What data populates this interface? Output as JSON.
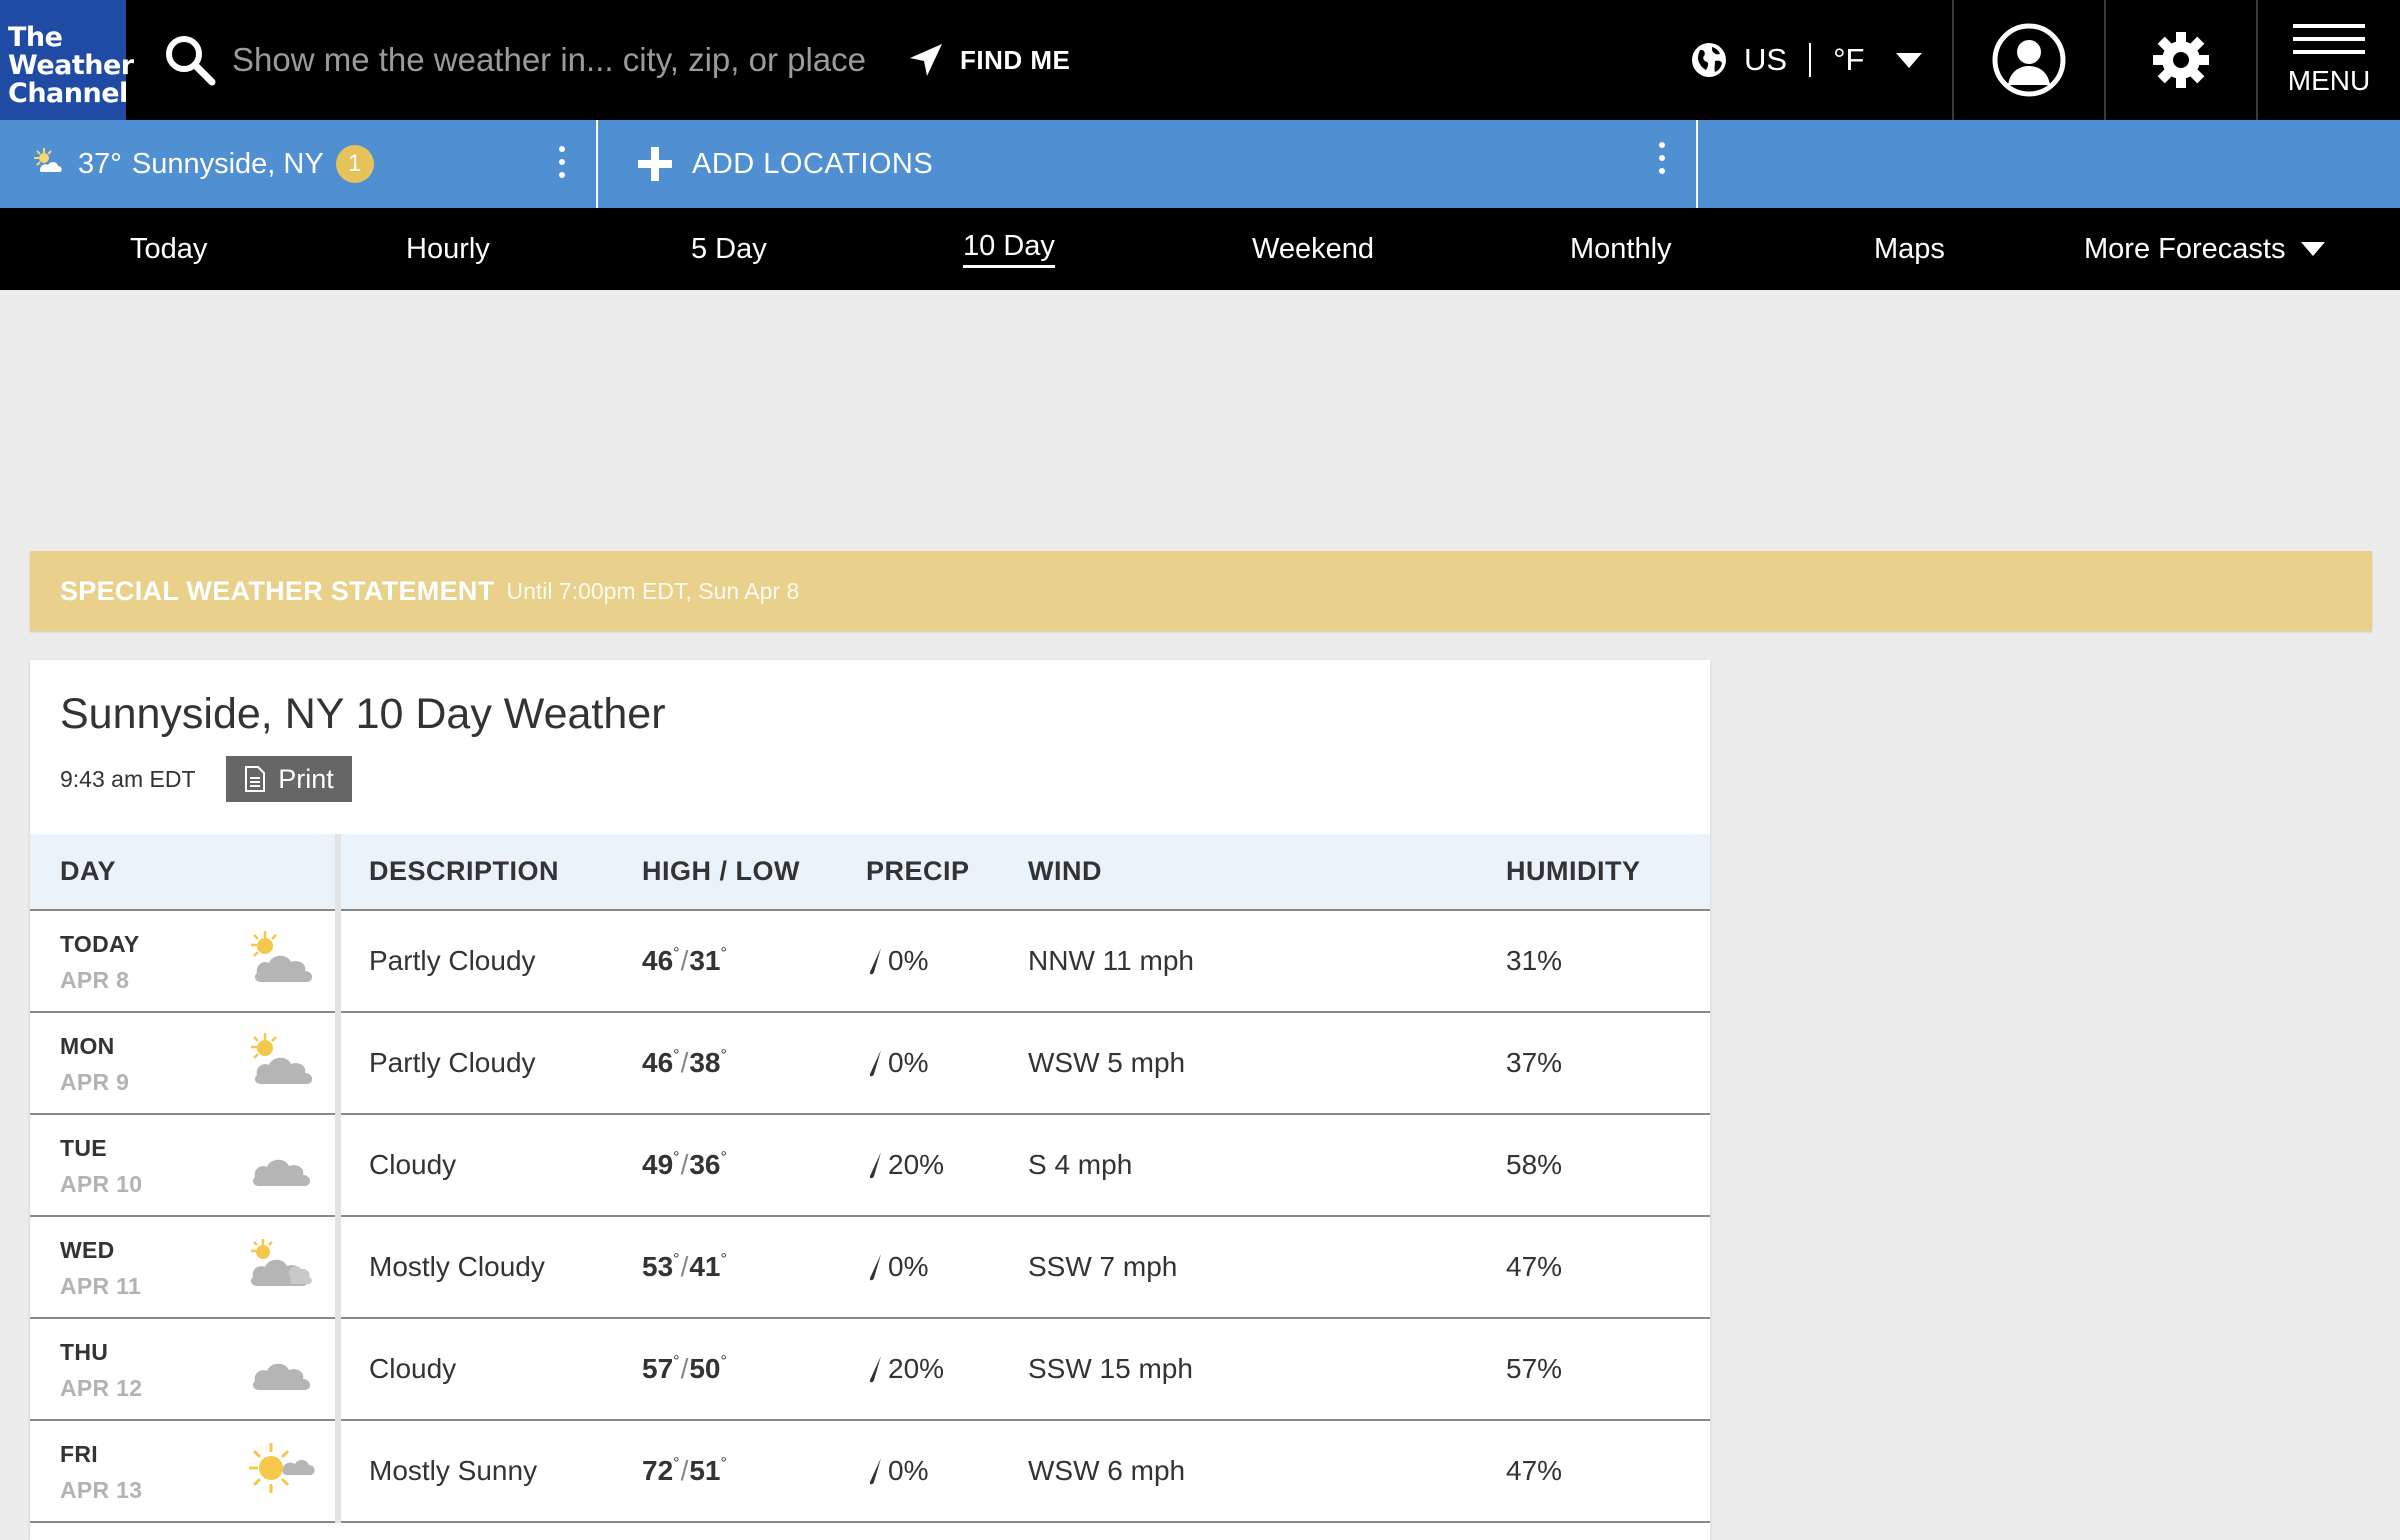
{
  "header": {
    "logo": [
      "The",
      "Weather",
      "Channel"
    ],
    "search_placeholder": "Show me the weather in... city, zip, or place",
    "find_me": "FIND ME",
    "region": "US",
    "unit": "°F",
    "menu": "MENU"
  },
  "location_bar": {
    "temp": "37°",
    "city": "Sunnyside, NY",
    "badge": "1",
    "add_locations": "ADD LOCATIONS"
  },
  "nav": {
    "items": [
      "Today",
      "Hourly",
      "5 Day",
      "10 Day",
      "Weekend",
      "Monthly",
      "Maps",
      "More Forecasts"
    ],
    "active": "10 Day"
  },
  "alert": {
    "title": "SPECIAL WEATHER STATEMENT",
    "until": "Until 7:00pm EDT, Sun Apr 8"
  },
  "forecast": {
    "title": "Sunnyside, NY 10 Day Weather",
    "time": "9:43 am EDT",
    "print": "Print",
    "columns": [
      "DAY",
      "DESCRIPTION",
      "HIGH / LOW",
      "PRECIP",
      "WIND",
      "HUMIDITY"
    ],
    "rows": [
      {
        "day": "TODAY",
        "date": "APR 8",
        "icon": "partly-cloudy-icon",
        "desc": "Partly Cloudy",
        "high": "46",
        "low": "31",
        "precip": "0%",
        "wind": "NNW 11 mph",
        "humidity": "31%"
      },
      {
        "day": "MON",
        "date": "APR 9",
        "icon": "partly-cloudy-icon",
        "desc": "Partly Cloudy",
        "high": "46",
        "low": "38",
        "precip": "0%",
        "wind": "WSW 5 mph",
        "humidity": "37%"
      },
      {
        "day": "TUE",
        "date": "APR 10",
        "icon": "cloudy-icon",
        "desc": "Cloudy",
        "high": "49",
        "low": "36",
        "precip": "20%",
        "wind": "S 4 mph",
        "humidity": "58%"
      },
      {
        "day": "WED",
        "date": "APR 11",
        "icon": "mostly-cloudy-icon",
        "desc": "Mostly Cloudy",
        "high": "53",
        "low": "41",
        "precip": "0%",
        "wind": "SSW 7 mph",
        "humidity": "47%"
      },
      {
        "day": "THU",
        "date": "APR 12",
        "icon": "cloudy-icon",
        "desc": "Cloudy",
        "high": "57",
        "low": "50",
        "precip": "20%",
        "wind": "SSW 15 mph",
        "humidity": "57%"
      },
      {
        "day": "FRI",
        "date": "APR 13",
        "icon": "mostly-sunny-icon",
        "desc": "Mostly Sunny",
        "high": "72",
        "low": "51",
        "precip": "0%",
        "wind": "WSW 6 mph",
        "humidity": "47%"
      }
    ]
  },
  "colors": {
    "top_bar": "#000000",
    "logo_bg": "#1f4ba5",
    "location_bar": "#4f8fd2",
    "alert_bg": "#e9d18c",
    "badge": "#e6c35a",
    "table_header": "#eaf2fa"
  }
}
